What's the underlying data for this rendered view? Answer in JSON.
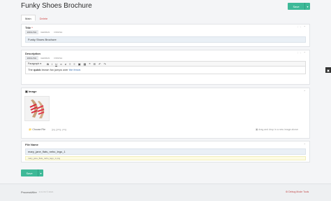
{
  "header": {
    "title": "Funky Shoes Brochure",
    "save_label": "Save"
  },
  "tabs": [
    {
      "label": "Main"
    },
    {
      "label": "Delete"
    }
  ],
  "languages": [
    "ENGLISH",
    "GERMAN",
    "FINNISH"
  ],
  "title_field": {
    "label": "Title",
    "required_mark": "*",
    "value": "Funky Shoes Brochure"
  },
  "description_field": {
    "label": "Description",
    "format": "Paragraph",
    "text_before": "The ",
    "text_bold": "quick",
    "text_middle": " brown fox jumps over ",
    "text_link": "the fence",
    "text_after": "."
  },
  "image_field": {
    "label": "Image",
    "choose_label": "Choose File",
    "types_hint": "jpg, jpeg, png",
    "drop_hint": "drag and drop in a new image above"
  },
  "file_name_field": {
    "label": "File Name",
    "value": "mary_jane_flats_nebo_lego_1",
    "hint": "mary_jane_flats_nebo_lego_1.png"
  },
  "footer": {
    "brand": "ProcessWire",
    "version": "3.0.172 © 2021",
    "debug": "Debug Mode Tools"
  },
  "icons": {
    "folder": "folder-icon",
    "collapse": "chevron-up-icon",
    "camera": "camera-icon",
    "expand": "chevron-down-icon"
  }
}
